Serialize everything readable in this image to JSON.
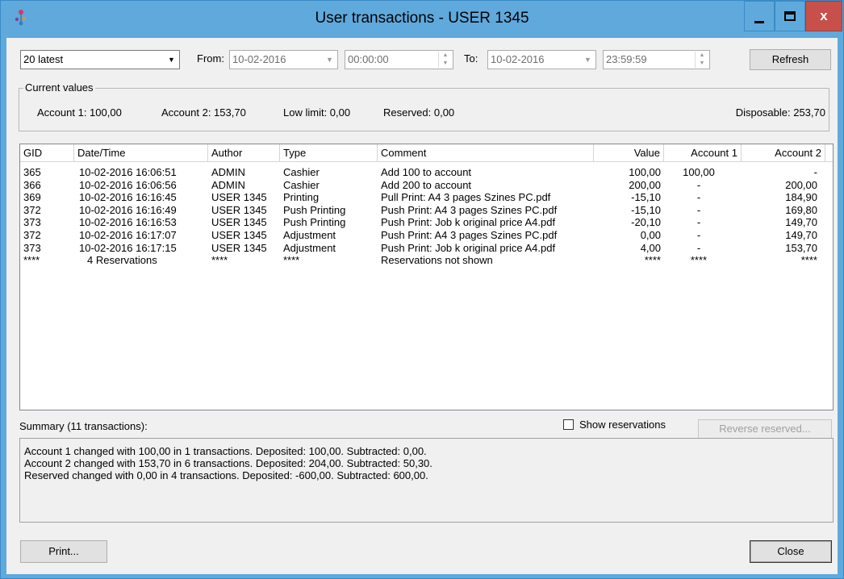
{
  "window": {
    "title": "User transactions - USER 1345",
    "close_glyph": "x"
  },
  "toolbar": {
    "range_select": "20 latest",
    "from_label": "From:",
    "from_date": "10-02-2016",
    "from_time": "00:00:00",
    "to_label": "To:",
    "to_date": "10-02-2016",
    "to_time": "23:59:59",
    "refresh_label": "Refresh"
  },
  "current_values": {
    "title": "Current values",
    "account1": "Account 1: 100,00",
    "account2": "Account 2: 153,70",
    "low_limit": "Low limit: 0,00",
    "reserved": "Reserved: 0,00",
    "disposable": "Disposable: 253,70"
  },
  "table": {
    "columns": [
      "GID",
      "Date/Time",
      "Author",
      "Type",
      "Comment",
      "Value",
      "Account 1",
      "Account 2"
    ],
    "rows": [
      [
        "365",
        "10-02-2016 16:06:51",
        "ADMIN",
        "Cashier",
        "Add 100 to account",
        "100,00",
        "100,00",
        "-"
      ],
      [
        "366",
        "10-02-2016 16:06:56",
        "ADMIN",
        "Cashier",
        "Add 200 to account",
        "200,00",
        "-",
        "200,00"
      ],
      [
        "369",
        "10-02-2016 16:16:45",
        "USER 1345",
        "Printing",
        "Pull Print: A4 3 pages Szines PC.pdf",
        "-15,10",
        "-",
        "184,90"
      ],
      [
        "372",
        "10-02-2016 16:16:49",
        "USER 1345",
        "Push Printing",
        "Push Print: A4 3 pages Szines PC.pdf",
        "-15,10",
        "-",
        "169,80"
      ],
      [
        "373",
        "10-02-2016 16:16:53",
        "USER 1345",
        "Push Printing",
        "Push Print: Job k original price A4.pdf",
        "-20,10",
        "-",
        "149,70"
      ],
      [
        "372",
        "10-02-2016 16:17:07",
        "USER 1345",
        "Adjustment",
        "Push Print: A4 3 pages Szines PC.pdf",
        "0,00",
        "-",
        "149,70"
      ],
      [
        "373",
        "10-02-2016 16:17:15",
        "USER 1345",
        "Adjustment",
        "Push Print: Job k original price A4.pdf",
        "4,00",
        "-",
        "153,70"
      ],
      [
        "****",
        "4 Reservations",
        "****",
        "****",
        "Reservations not shown",
        "****",
        "****",
        "****"
      ]
    ]
  },
  "summary": {
    "label": "Summary (11 transactions):",
    "show_reservations_label": "Show reservations",
    "reverse_reserved_label": "Reverse reserved...",
    "lines": [
      "Account 1 changed with 100,00 in 1 transactions.  Deposited: 100,00. Subtracted: 0,00.",
      "Account 2 changed with 153,70 in 6 transactions.  Deposited: 204,00. Subtracted: 50,30.",
      "Reserved changed with 0,00 in 4 transactions. Deposited: -600,00. Subtracted: 600,00."
    ]
  },
  "footer": {
    "print_label": "Print...",
    "close_label": "Close"
  }
}
